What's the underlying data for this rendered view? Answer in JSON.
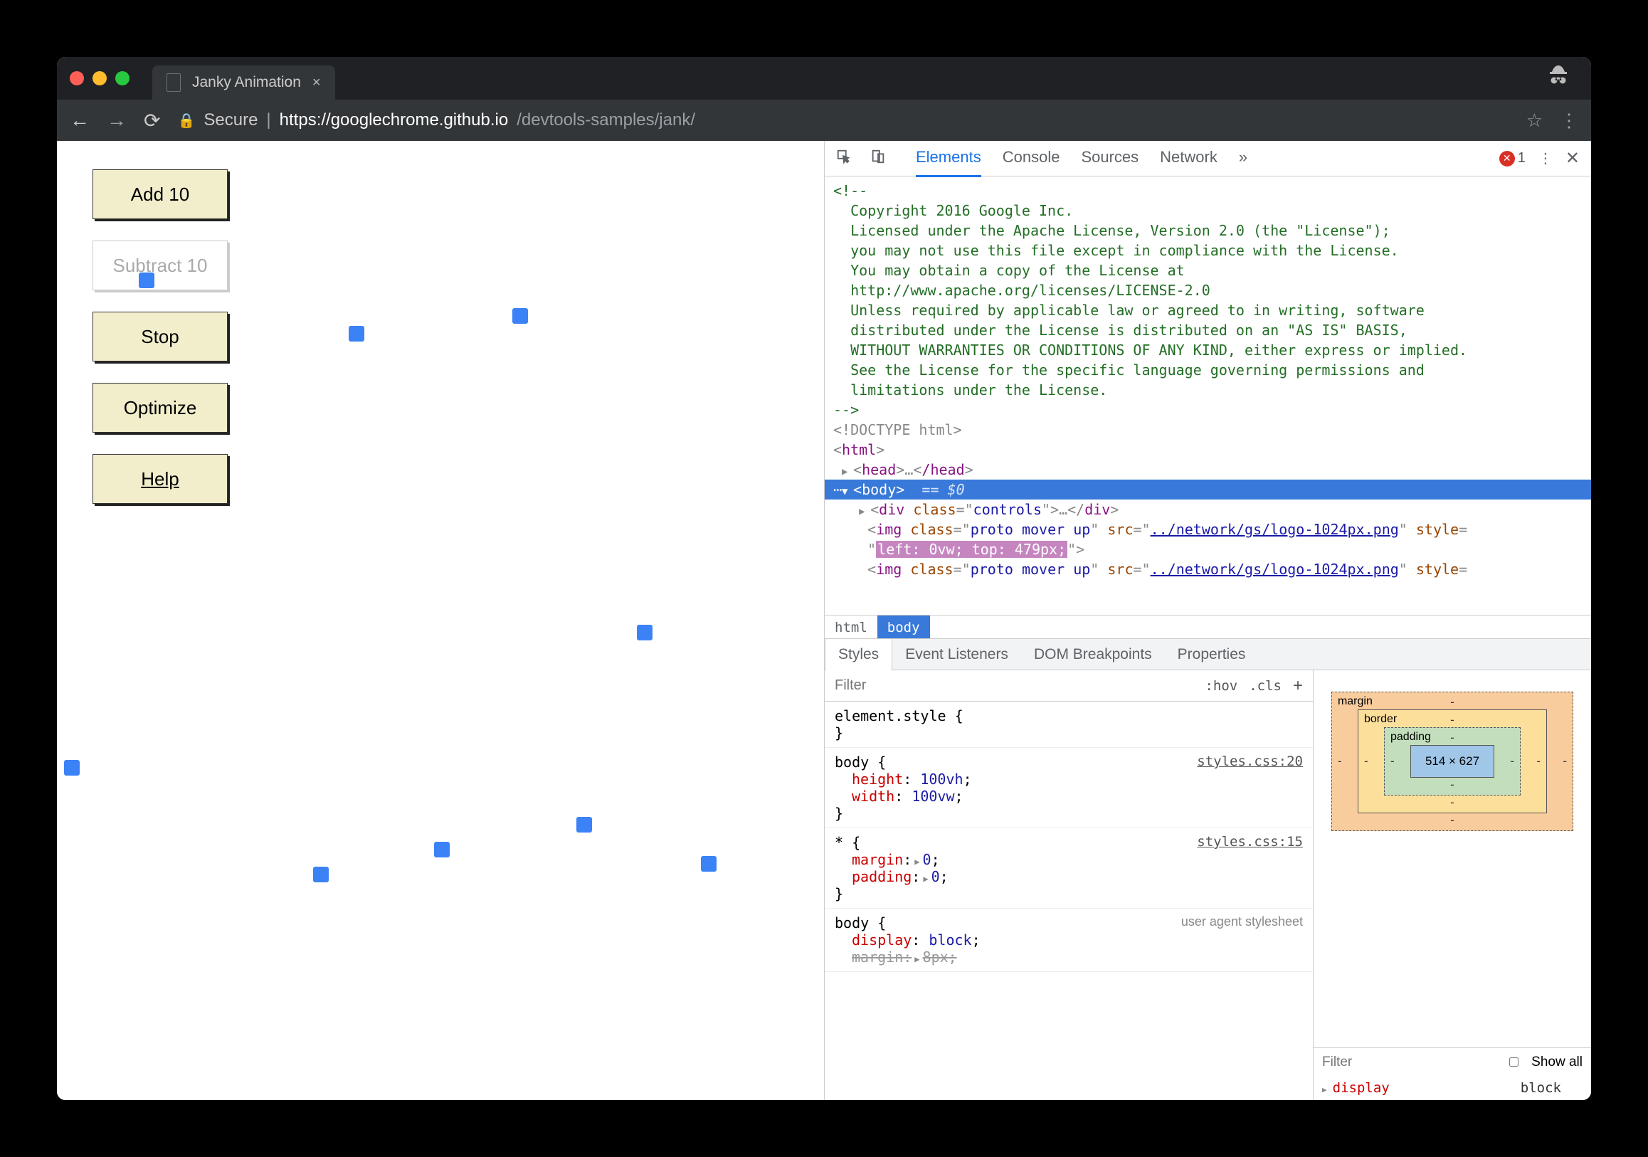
{
  "window": {
    "tab_title": "Janky Animation"
  },
  "addressbar": {
    "secure_label": "Secure",
    "url_host": "https://googlechrome.github.io",
    "url_path": "/devtools-samples/jank/"
  },
  "page_buttons": {
    "add": "Add 10",
    "subtract": "Subtract 10",
    "stop": "Stop",
    "optimize": "Optimize",
    "help": "Help"
  },
  "devtools": {
    "tabs": [
      "Elements",
      "Console",
      "Sources",
      "Network"
    ],
    "more_glyph": "»",
    "error_count": "1",
    "comment_lines": [
      "<!--",
      "  Copyright 2016 Google Inc.",
      "",
      "  Licensed under the Apache License, Version 2.0 (the \"License\");",
      "  you may not use this file except in compliance with the License.",
      "  You may obtain a copy of the License at",
      "",
      "  http://www.apache.org/licenses/LICENSE-2.0",
      "",
      "  Unless required by applicable law or agreed to in writing, software",
      "  distributed under the License is distributed on an \"AS IS\" BASIS,",
      "  WITHOUT WARRANTIES OR CONDITIONS OF ANY KIND, either express or implied.",
      "  See the License for the specific language governing permissions and",
      "  limitations under the License.",
      "-->"
    ],
    "doctype": "<!DOCTYPE html>",
    "html_open": "html",
    "head_open": "head",
    "head_close": "/head",
    "body_open": "body",
    "eq_dollar": "== $0",
    "div_controls_class": "controls",
    "img_class": "proto mover up",
    "img_src": "../network/gs/logo-1024px.png",
    "img_style_hl": "left: 0vw; top: 479px;",
    "breadcrumb": [
      "html",
      "body"
    ],
    "sub_tabs": [
      "Styles",
      "Event Listeners",
      "DOM Breakpoints",
      "Properties"
    ],
    "filter_placeholder": "Filter",
    "hov": ":hov",
    "cls": ".cls",
    "rules": {
      "element_style": "element.style {",
      "body_sel": "body {",
      "body_src": "styles.css:20",
      "height": "height",
      "height_v": "100vh",
      "width": "width",
      "width_v": "100vw",
      "star_sel": "* {",
      "star_src": "styles.css:15",
      "margin": "margin",
      "padding": "padding",
      "zero": "0",
      "ua_label": "user agent stylesheet",
      "display": "display",
      "block": "block",
      "margin_8": "8px"
    },
    "box_model": {
      "margin": "margin",
      "border": "border",
      "padding": "padding",
      "dims": "514 × 627"
    },
    "computed_filter": "Filter",
    "show_all": "Show all",
    "computed": {
      "display": "display",
      "display_v": "block"
    }
  }
}
